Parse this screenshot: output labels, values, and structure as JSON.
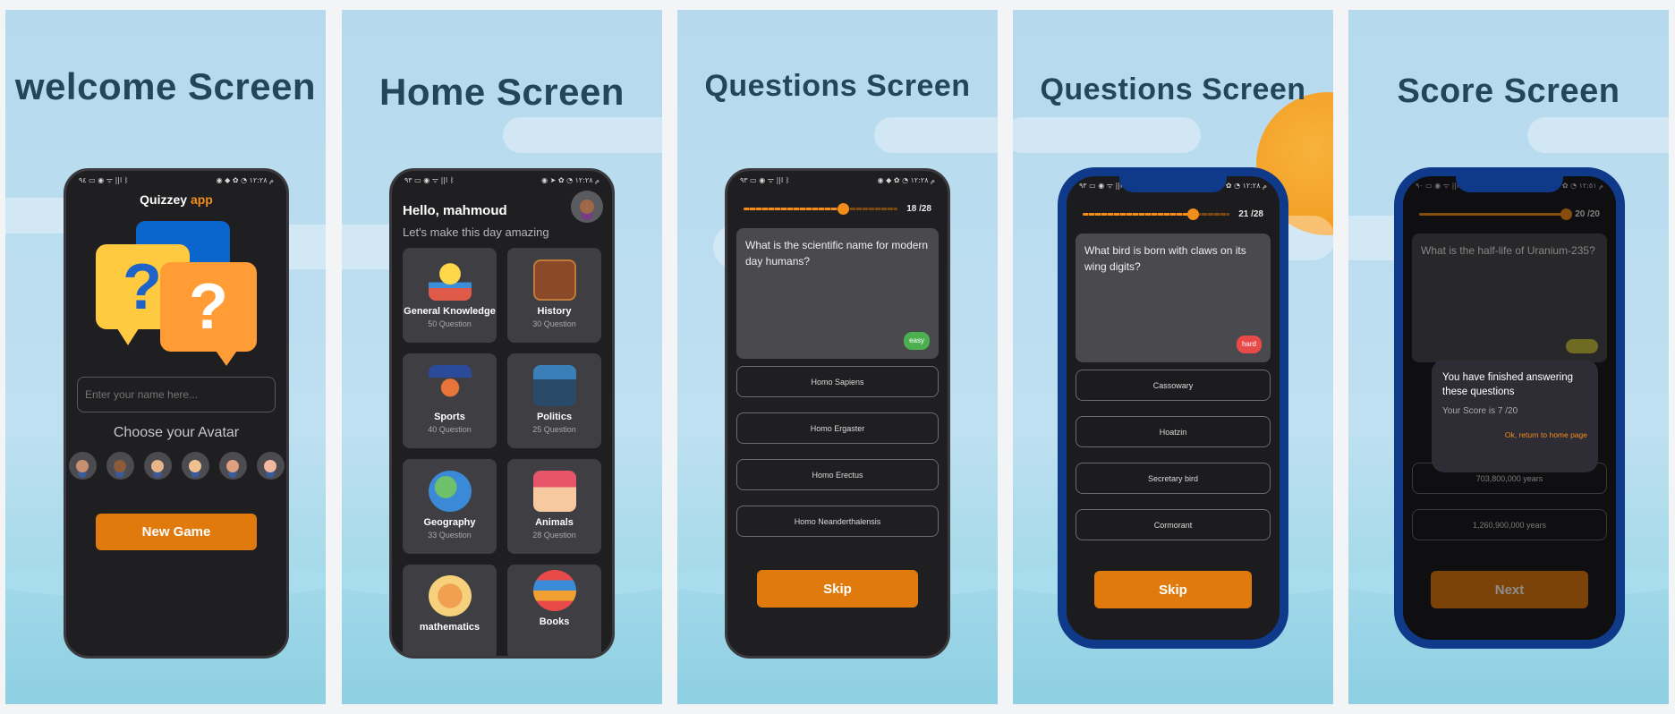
{
  "colors": {
    "accent": "#f28c1b",
    "button": "#e17a0d",
    "easy": "#4caf50",
    "hard": "#e84a4a",
    "title": "#24465c"
  },
  "panels": {
    "welcome": {
      "title": "welcome Screen",
      "status": {
        "left": "٩٤ ▭ ◉ ᯤ ||l ᛒ",
        "right": "◉ ◆ ✿ ◔ م ١٢:٢٨"
      },
      "app_title": "Quizzey",
      "app_title_accent": "app",
      "input_placeholder": "Enter your name here...",
      "choose_label": "Choose your Avatar",
      "button": "New Game"
    },
    "home": {
      "title": "Home Screen",
      "status": {
        "left": "٩٣ ▭ ◉ ᯤ ||l ᛒ",
        "right": "◉ ➤ ✿ ◔ م ١٢:٢٨"
      },
      "greeting": "Hello, mahmoud",
      "tagline": "Let's make this day amazing",
      "categories": [
        {
          "name": "General Knowledge",
          "count": "50 Question",
          "icon": "lightbulb-books-icon"
        },
        {
          "name": "History",
          "count": "30 Question",
          "icon": "spartan-helmet-book-icon"
        },
        {
          "name": "Sports",
          "count": "40 Question",
          "icon": "sports-equipment-icon"
        },
        {
          "name": "Politics",
          "count": "25 Question",
          "icon": "politics-crowd-icon"
        },
        {
          "name": "Geography",
          "count": "33 Question",
          "icon": "globe-icon"
        },
        {
          "name": "Animals",
          "count": "28 Question",
          "icon": "animal-house-icon"
        },
        {
          "name": "mathematics",
          "count": "",
          "icon": "calculator-icon"
        },
        {
          "name": "Books",
          "count": "",
          "icon": "book-stack-icon"
        }
      ]
    },
    "question1": {
      "title": "Questions Screen",
      "status": {
        "left": "٩٣ ▭ ◉ ᯤ ||l ᛒ",
        "right": "◉ ◆ ✿ ◔ م ١٢:٢٨"
      },
      "progress": 0.6428,
      "count": "18 /28",
      "question": "What is the scientific name for modern day humans?",
      "difficulty": "easy",
      "answers": [
        "Homo Sapiens",
        "Homo Ergaster",
        "Homo Erectus",
        "Homo Neanderthalensis"
      ],
      "button": "Skip"
    },
    "question2": {
      "title": "Questions Screen",
      "status": {
        "left": "٩٣ ▭ ◉ ᯤ ||l",
        "right": "◉ ◆ ✿ ◔ م ١٢:٢٨"
      },
      "progress": 0.75,
      "count": "21 /28",
      "question": "What bird is born with claws on its wing digits?",
      "difficulty": "hard",
      "answers": [
        "Cassowary",
        "Hoatzin",
        "Secretary bird",
        "Cormorant"
      ],
      "button": "Skip"
    },
    "score": {
      "title": "Score Screen",
      "status": {
        "left": "٩٠ ▭ ◉ ᯤ ||l",
        "right": "◉ ◆ ✿ ◔ م ١٢:٥١"
      },
      "progress": 1.0,
      "count": "20 /20",
      "question": "What is the half-life of Uranium-235?",
      "answers": [
        "703,800,000 years",
        "1,260,900,000 years"
      ],
      "button": "Next",
      "dialog": {
        "message": "You have finished answering these questions",
        "score": "Your Score is 7 /20",
        "action": "Ok, return to home page"
      }
    }
  }
}
